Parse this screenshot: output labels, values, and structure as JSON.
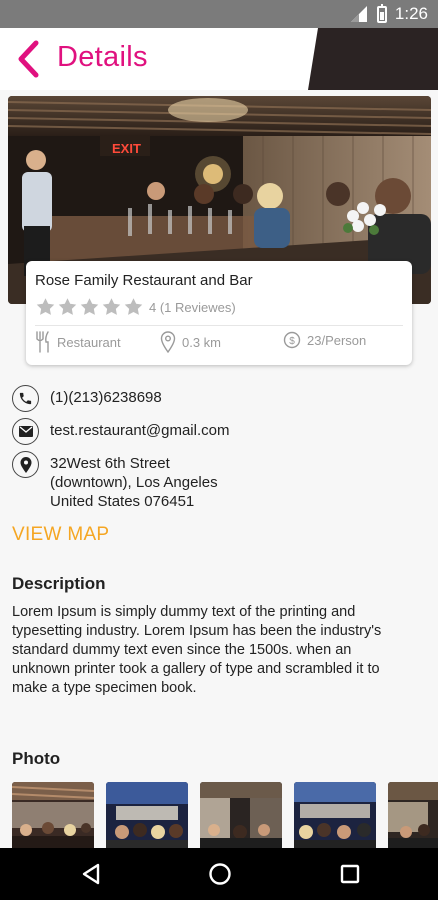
{
  "status_bar": {
    "time": "1:26"
  },
  "app_bar": {
    "title": "Details",
    "back_icon": "chevron-left-icon"
  },
  "restaurant": {
    "name": "Rose Family Restaurant and Bar",
    "rating": 4,
    "rating_max": 5,
    "reviews_text": "4 (1 Reviewes)",
    "category": "Restaurant",
    "distance": "0.3 km",
    "price": "23/Person",
    "hero_sign": "EXIT"
  },
  "contact": {
    "phone": "(1)(213)6238698",
    "email": "test.restaurant@gmail.com",
    "address_lines": [
      "32West 6th Street",
      "(downtown), Los Angeles",
      "United States 076451"
    ]
  },
  "actions": {
    "view_map": "VIEW MAP"
  },
  "description": {
    "heading": "Description",
    "lines": [
      "Lorem Ipsum is simply dummy text of the printing and",
      "typesetting industry. Lorem Ipsum has been the industry's",
      "standard dummy text even since the 1500s. when an",
      "unknown printer took a gallery of type and scrambled it to",
      "make a type specimen book."
    ]
  },
  "photos": {
    "heading": "Photo",
    "count_visible": 5
  },
  "colors": {
    "accent": "#e0117f",
    "link": "#f5a623",
    "status_bar": "#7b7b7b",
    "nav_bar": "#000000"
  },
  "nav": {
    "back": "nav-back-icon",
    "home": "nav-home-icon",
    "recents": "nav-recents-icon"
  }
}
